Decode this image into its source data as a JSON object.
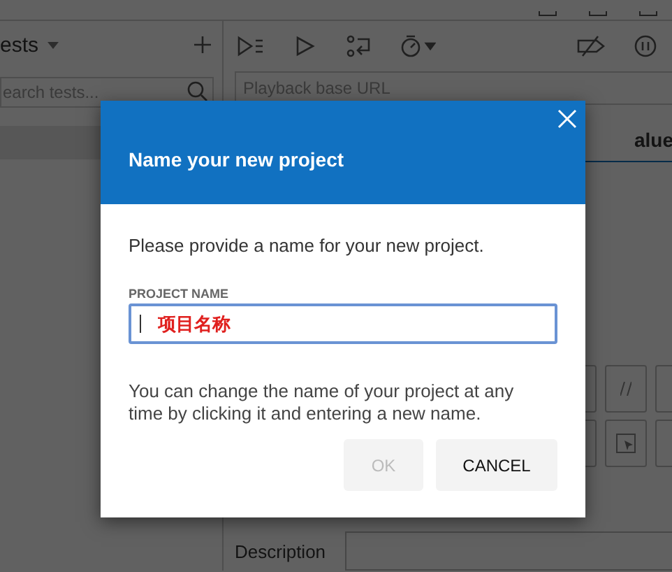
{
  "background": {
    "suite_selector": "ests",
    "search": {
      "placeholder": "earch tests..."
    },
    "base_url": {
      "placeholder": "Playback base URL"
    },
    "column_header": "alue",
    "description_label": "Description"
  },
  "dialog": {
    "title": "Name your new project",
    "prompt": "Please provide a name for your new project.",
    "field_label": "PROJECT NAME",
    "field_value": "项目名称",
    "note": "You can change the name of your project at any time by clicking it and entering a new name.",
    "buttons": [
      {
        "label": "OK",
        "disabled": true
      },
      {
        "label": "CANCEL",
        "disabled": false
      }
    ]
  }
}
